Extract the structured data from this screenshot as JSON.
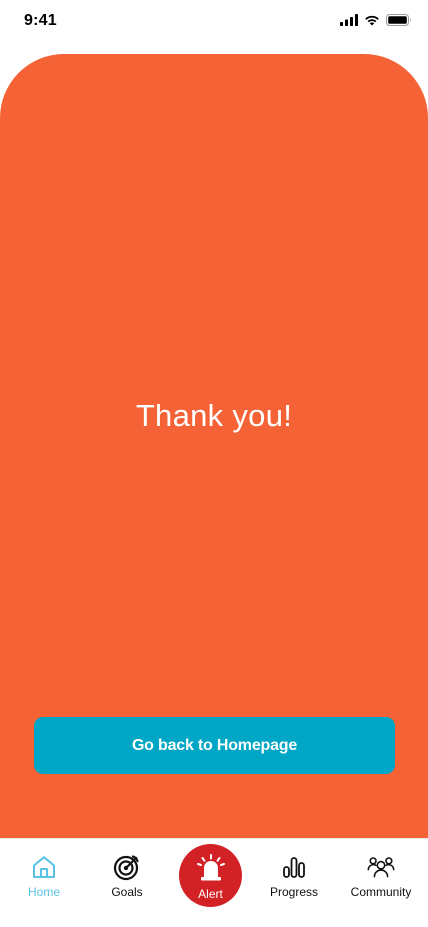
{
  "status_bar": {
    "time": "9:41",
    "icons": [
      "cellular-signal-icon",
      "wifi-icon",
      "battery-icon"
    ]
  },
  "main": {
    "heading": "Thank you!",
    "button_label": "Go back to Homepage"
  },
  "tab_bar": {
    "items": [
      {
        "label": "Home",
        "icon": "home-icon",
        "active": true
      },
      {
        "label": "Goals",
        "icon": "target-icon",
        "active": false
      },
      {
        "label": "Alert",
        "icon": "siren-icon",
        "active": false
      },
      {
        "label": "Progress",
        "icon": "bar-chart-icon",
        "active": false
      },
      {
        "label": "Community",
        "icon": "people-icon",
        "active": false
      }
    ]
  },
  "colors": {
    "card_background": "#f46236",
    "button_background": "#00a6c6",
    "alert_background": "#d32226",
    "active_tab": "#5bc2e7",
    "text_white": "#ffffff"
  }
}
